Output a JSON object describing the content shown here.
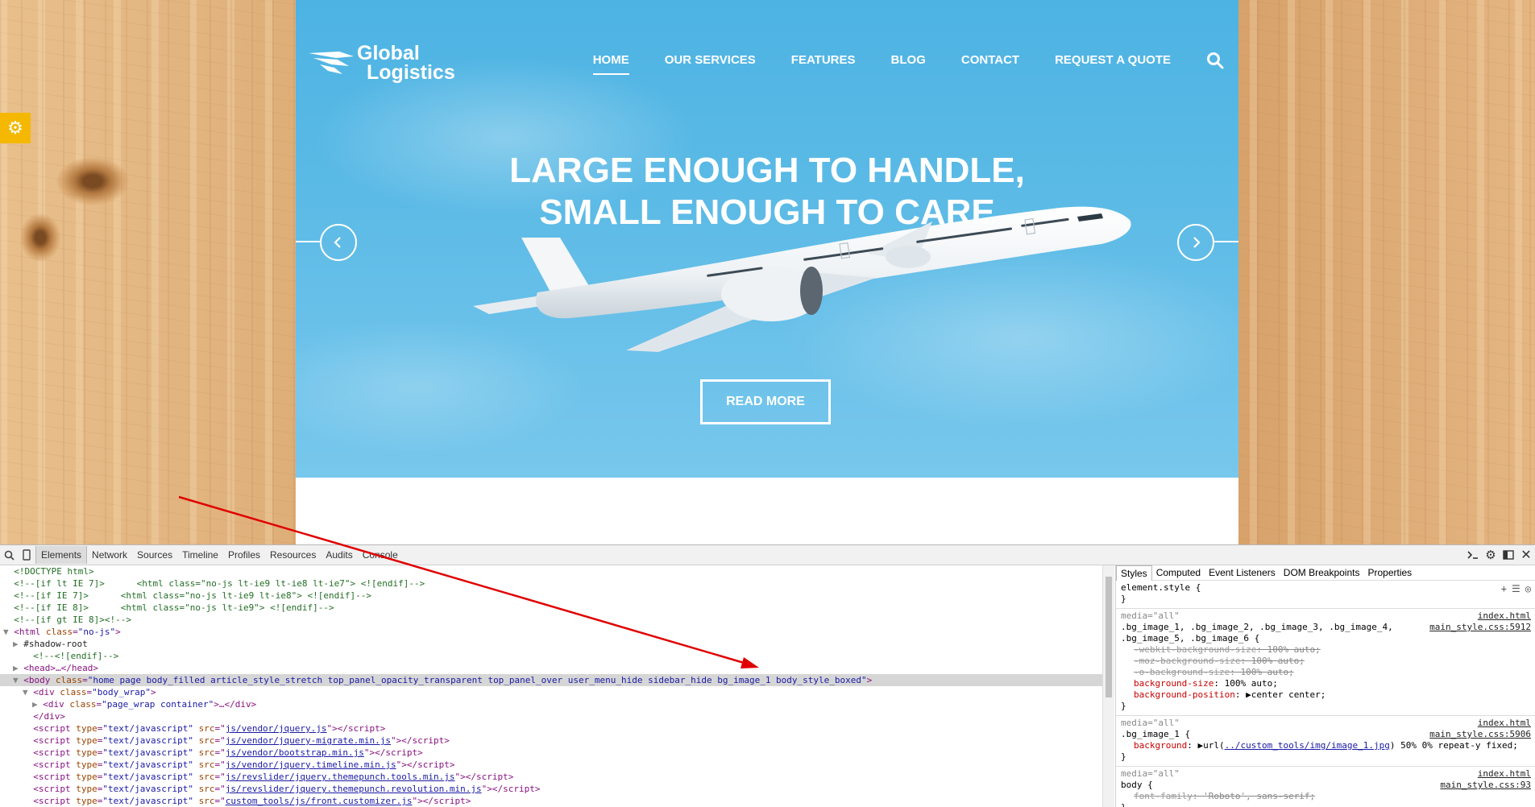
{
  "site": {
    "logo": {
      "line1": "Global",
      "line2": "Logistics"
    },
    "nav": [
      {
        "label": "HOME",
        "active": true
      },
      {
        "label": "OUR SERVICES"
      },
      {
        "label": "FEATURES"
      },
      {
        "label": "BLOG"
      },
      {
        "label": "CONTACT"
      },
      {
        "label": "REQUEST A QUOTE"
      }
    ],
    "hero": {
      "title_line1": "LARGE ENOUGH TO HANDLE,",
      "title_line2": "SMALL ENOUGH TO CARE",
      "button": "READ MORE"
    },
    "colors": {
      "sky": "#5dbbe6",
      "settings": "#f5b800",
      "annotation_arrow": "#e00000"
    }
  },
  "devtools": {
    "tabs": [
      "Elements",
      "Network",
      "Sources",
      "Timeline",
      "Profiles",
      "Resources",
      "Audits",
      "Console"
    ],
    "active_tab": "Elements",
    "dom_lines": [
      {
        "indent": 0,
        "type": "comment",
        "text": "<!DOCTYPE html>"
      },
      {
        "indent": 0,
        "type": "cond",
        "cond": "<!--[if lt IE 7]>",
        "code": "<html class=\"no-js lt-ie9 lt-ie8 lt-ie7\"> <![endif]-->"
      },
      {
        "indent": 0,
        "type": "cond",
        "cond": "<!--[if IE 7]>",
        "code": "<html class=\"no-js lt-ie9 lt-ie8\"> <![endif]-->"
      },
      {
        "indent": 0,
        "type": "cond",
        "cond": "<!--[if IE 8]>",
        "code": "<html class=\"no-js lt-ie9\"> <![endif]-->"
      },
      {
        "indent": 0,
        "type": "comment",
        "text": "<!--[if gt IE 8]><!-->"
      },
      {
        "indent": 0,
        "type": "tag",
        "toggle": "▼",
        "text": "<html class=\"no-js\">"
      },
      {
        "indent": 1,
        "type": "plain",
        "toggle": "▶",
        "text": "#shadow-root"
      },
      {
        "indent": 2,
        "type": "comment",
        "text": "<!--<![endif]-->"
      },
      {
        "indent": 1,
        "type": "tag",
        "toggle": "▶",
        "text": "<head>…</head>"
      },
      {
        "indent": 1,
        "type": "tag",
        "toggle": "▼",
        "selected": true,
        "text": "<body class=\"home page body_filled article_style_stretch top_panel_opacity_transparent top_panel_over user_menu_hide sidebar_hide bg_image_1 body_style_boxed\">"
      },
      {
        "indent": 2,
        "type": "tag",
        "toggle": "▼",
        "text": "<div class=\"body_wrap\">"
      },
      {
        "indent": 3,
        "type": "tag",
        "toggle": "▶",
        "text": "<div class=\"page_wrap container\">…</div>"
      },
      {
        "indent": 2,
        "type": "tag",
        "text": "</div>"
      },
      {
        "indent": 2,
        "type": "script",
        "src": "js/vendor/jquery.js"
      },
      {
        "indent": 2,
        "type": "script",
        "src": "js/vendor/jquery-migrate.min.js"
      },
      {
        "indent": 2,
        "type": "script",
        "src": "js/vendor/bootstrap.min.js"
      },
      {
        "indent": 2,
        "type": "script",
        "src": "js/vendor/jquery.timeline.min.js"
      },
      {
        "indent": 2,
        "type": "script",
        "src": "js/revslider/jquery.themepunch.tools.min.js"
      },
      {
        "indent": 2,
        "type": "script",
        "src": "js/revslider/jquery.themepunch.revolution.min.js"
      },
      {
        "indent": 2,
        "type": "script",
        "src": "custom_tools/js/front.customizer.js"
      }
    ],
    "styles_tabs": [
      "Styles",
      "Computed",
      "Event Listeners",
      "DOM Breakpoints",
      "Properties"
    ],
    "active_styles_tab": "Styles",
    "rules": [
      {
        "media": "",
        "selector": "element.style {",
        "source": "",
        "source2": "",
        "props": []
      },
      {
        "media": "media=\"all\"",
        "selector": ".bg_image_1, .bg_image_2, .bg_image_3, .bg_image_4,",
        "selector2": ".bg_image_5, .bg_image_6 {",
        "source": "index.html",
        "source2": "main_style.css:5912",
        "props": [
          {
            "name": "-webkit-background-size",
            "value": "100% auto;",
            "strike": true
          },
          {
            "name": "-moz-background-size",
            "value": "100% auto;",
            "strike": true
          },
          {
            "name": "-o-background-size",
            "value": "100% auto;",
            "strike": true
          },
          {
            "name": "background-size",
            "value": "100% auto;"
          },
          {
            "name": "background-position",
            "value": "▶center center;"
          }
        ]
      },
      {
        "media": "media=\"all\"",
        "selector": ".bg_image_1 {",
        "source": "index.html",
        "source2": "main_style.css:5906",
        "props": [
          {
            "name": "background",
            "value": "▶url(",
            "link": "../custom_tools/img/image_1.jpg",
            "value_after": ") 50% 0% repeat-y fixed;"
          }
        ]
      },
      {
        "media": "media=\"all\"",
        "selector": "body {",
        "source": "index.html",
        "source2": "main_style.css:93",
        "props": [
          {
            "name": "font-family",
            "value": "'Roboto', sans-serif;",
            "strike": true
          }
        ]
      }
    ]
  }
}
